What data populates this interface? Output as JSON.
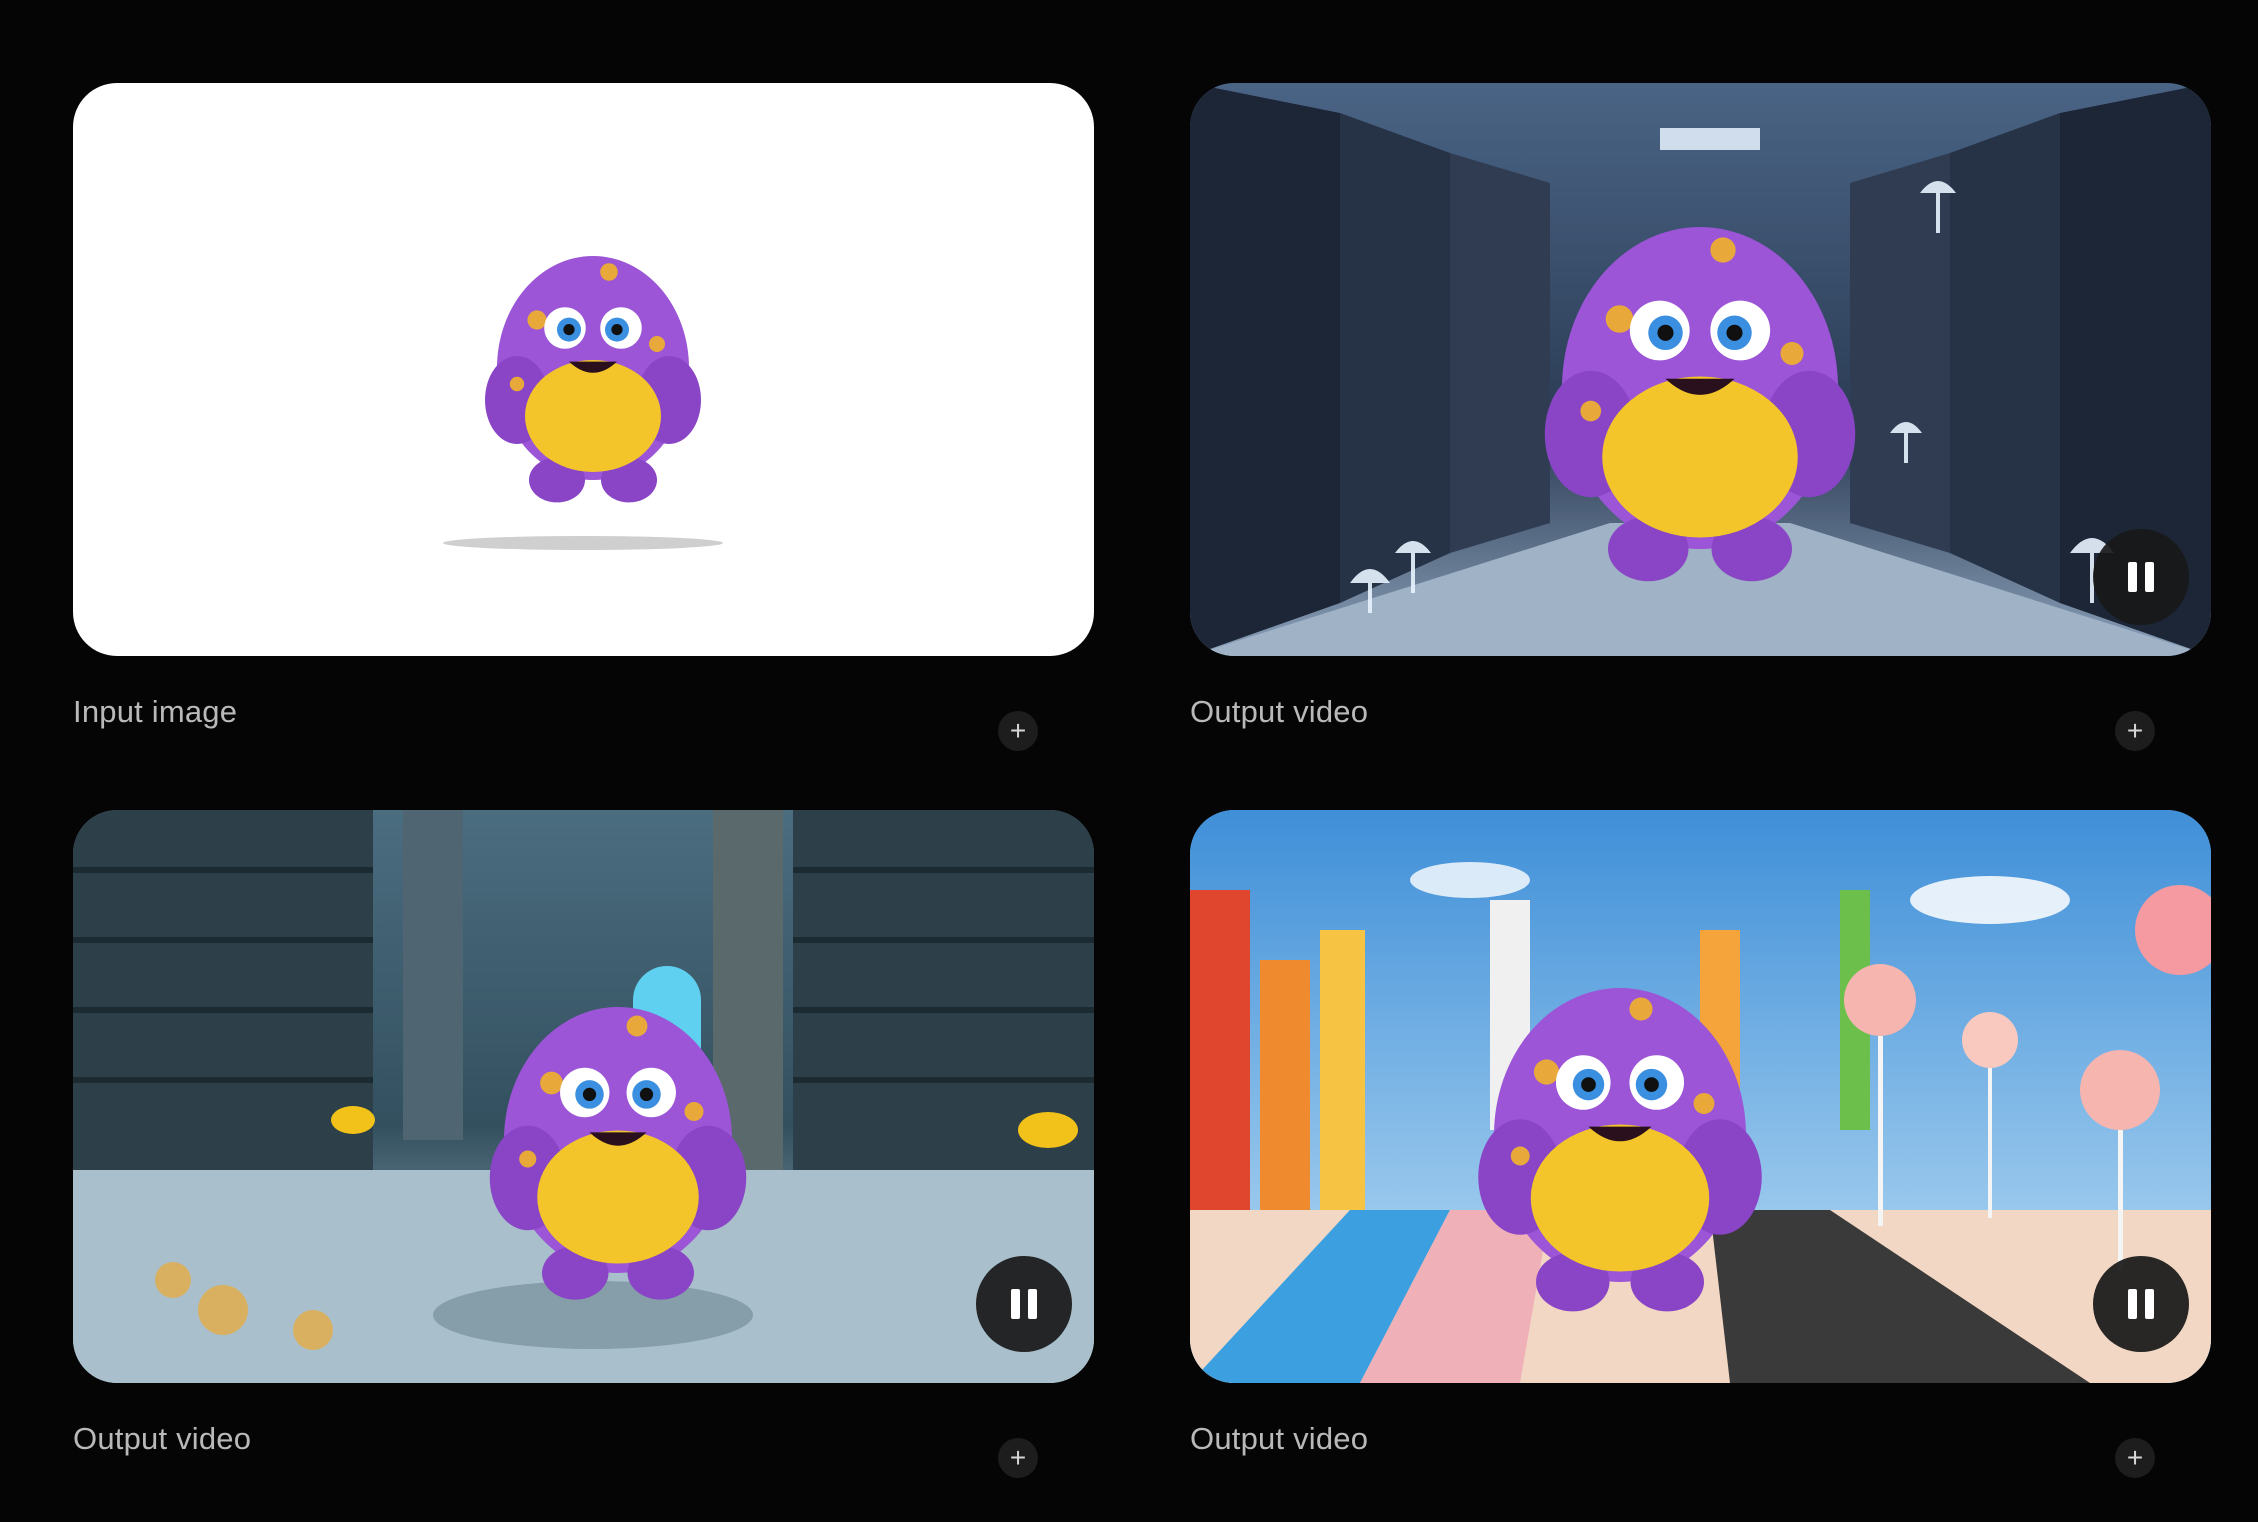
{
  "cards": [
    {
      "caption": "Input image",
      "media": "monster-white-background-image",
      "add_icon": "plus-icon"
    },
    {
      "caption": "Output video",
      "media": "monster-server-room-video",
      "control_icon": "pause-icon",
      "add_icon": "plus-icon"
    },
    {
      "caption": "Output video",
      "media": "monster-underwater-library-video",
      "control_icon": "pause-icon",
      "add_icon": "plus-icon"
    },
    {
      "caption": "Output video",
      "media": "monster-candy-land-video",
      "control_icon": "pause-icon",
      "add_icon": "plus-icon"
    }
  ],
  "plus_glyph": "+",
  "colors": {
    "background": "#050505",
    "caption": "#b9b9b9",
    "monster_fur": "#9b55d6",
    "monster_belly": "#f3c52a",
    "control_bg": "#181818"
  }
}
